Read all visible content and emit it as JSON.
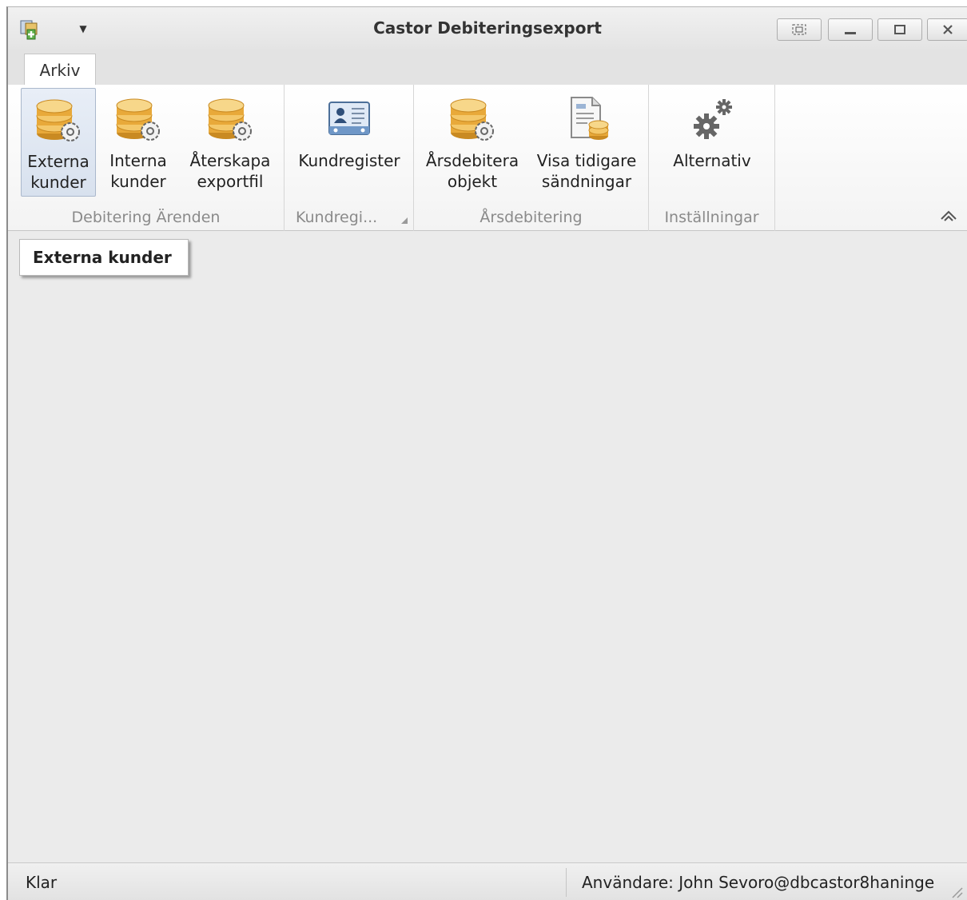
{
  "window": {
    "title": "Castor Debiteringsexport"
  },
  "tabs": [
    {
      "label": "Arkiv"
    }
  ],
  "ribbon": {
    "groups": [
      {
        "label": "Debitering Ärenden",
        "buttons": [
          {
            "line1": "Externa",
            "line2": "kunder",
            "icon": "coins-gear-icon"
          },
          {
            "line1": "Interna",
            "line2": "kunder",
            "icon": "coins-gear-icon"
          },
          {
            "line1": "Återskapa",
            "line2": "exportfil",
            "icon": "coins-gear-icon"
          }
        ]
      },
      {
        "label": "Kundregi...",
        "buttons": [
          {
            "line1": "Kundregister",
            "line2": "",
            "icon": "contact-card-icon"
          }
        ]
      },
      {
        "label": "Årsdebitering",
        "buttons": [
          {
            "line1": "Årsdebitera",
            "line2": "objekt",
            "icon": "coins-gear-icon"
          },
          {
            "line1": "Visa tidigare",
            "line2": "sändningar",
            "icon": "document-coins-icon"
          }
        ]
      },
      {
        "label": "Inställningar",
        "buttons": [
          {
            "line1": "Alternativ",
            "line2": "",
            "icon": "gears-icon"
          }
        ]
      }
    ]
  },
  "tooltip": {
    "text": "Externa kunder"
  },
  "statusbar": {
    "left": "Klar",
    "right": "Användare: John Sevoro@dbcastor8haninge"
  },
  "colors": {
    "coin_gold": "#e8a93a",
    "selected_bg": "#dde5f0",
    "group_label": "#8a8a8a"
  }
}
